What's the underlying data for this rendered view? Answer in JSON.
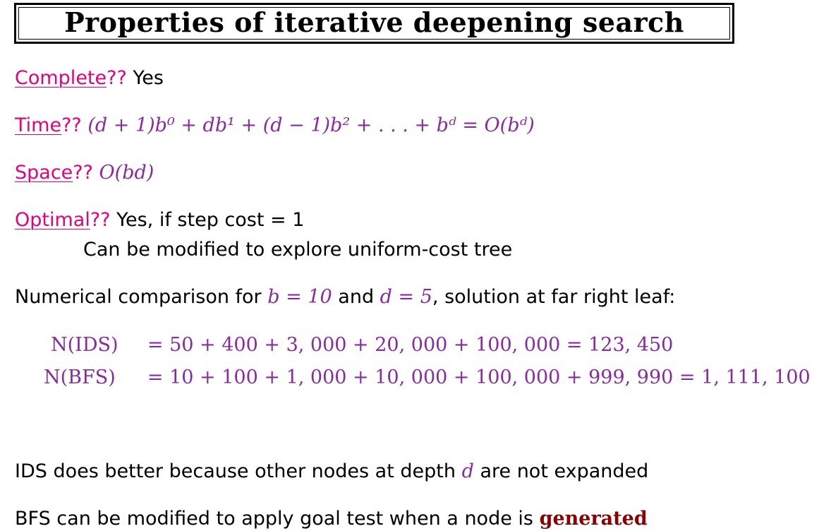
{
  "title": "Properties of iterative deepening search",
  "complete": {
    "label": "Complete",
    "q": "??",
    "answer": "Yes"
  },
  "time": {
    "label": "Time",
    "q": "??",
    "formula": "(d + 1)b⁰ + db¹ + (d − 1)b² + . . . + bᵈ = O(bᵈ)"
  },
  "space": {
    "label": "Space",
    "q": "??",
    "formula": "O(bd)"
  },
  "optimal": {
    "label": "Optimal",
    "q": "??",
    "answer": "Yes, if step cost = 1",
    "note": "Can be modified to explore uniform-cost tree"
  },
  "comparison": {
    "prefix": "Numerical comparison for",
    "b_eq": "b = 10",
    "and": "and",
    "d_eq": "d = 5",
    "suffix": ", solution at far right leaf:"
  },
  "ids_row": {
    "lhs": "N(IDS)",
    "rhs": "=  50 + 400 + 3, 000 + 20, 000 + 100, 000 = 123, 450"
  },
  "bfs_row": {
    "lhs": "N(BFS)",
    "rhs": "=  10 + 100 + 1, 000 + 10, 000 + 100, 000 + 999, 990 = 1, 111, 100"
  },
  "ids_better": {
    "before": "IDS does better because other nodes at depth",
    "var": "d",
    "after": "are not expanded"
  },
  "bfs_mod": {
    "text": "BFS can be modified to apply goal test when a node is",
    "emph": "generated"
  }
}
